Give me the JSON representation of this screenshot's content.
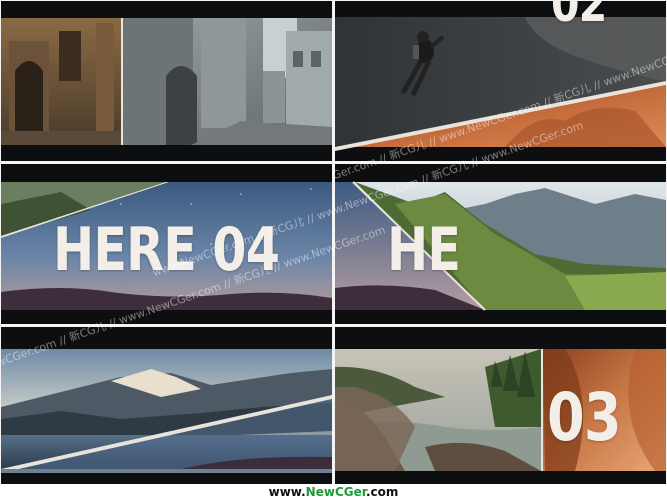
{
  "frames": {
    "frame2": {
      "title": "02"
    },
    "frame3": {
      "title": "HERE 04"
    },
    "frame4": {
      "title": "HE"
    },
    "frame6": {
      "title": "03"
    }
  },
  "watermark": {
    "text": "www.NewCGer.com // 新CG儿 // www.NewCGer.com // 新CG儿 //",
    "line_1": "www.NewCGer.com // 新CG儿 // www.NewCGer.com // 新CG儿 // www.NewCGer.com",
    "line_2": "NewCGer.com // 新CG儿 // www.NewCGer.com // 新CG儿 // www.NewCGer.com",
    "line_3": "Ger.com // 新CG儿 // www.NewCGer.com // 新CG儿 // www.NewCGer.com"
  },
  "footer": {
    "part_1": "www.",
    "part_2": "NewCGer",
    "part_3": ".com"
  },
  "colors": {
    "bar_dark": "#0d0e10",
    "title_text": "#f3efe8",
    "footer_green": "#1c9a35",
    "footer_text": "#111111"
  },
  "icons": {
    "frame1": "city-street-photo",
    "frame2": "scuba-diver-photo",
    "frame5": "mountain-lake-photo",
    "frame6": "river-canyon-photo"
  }
}
